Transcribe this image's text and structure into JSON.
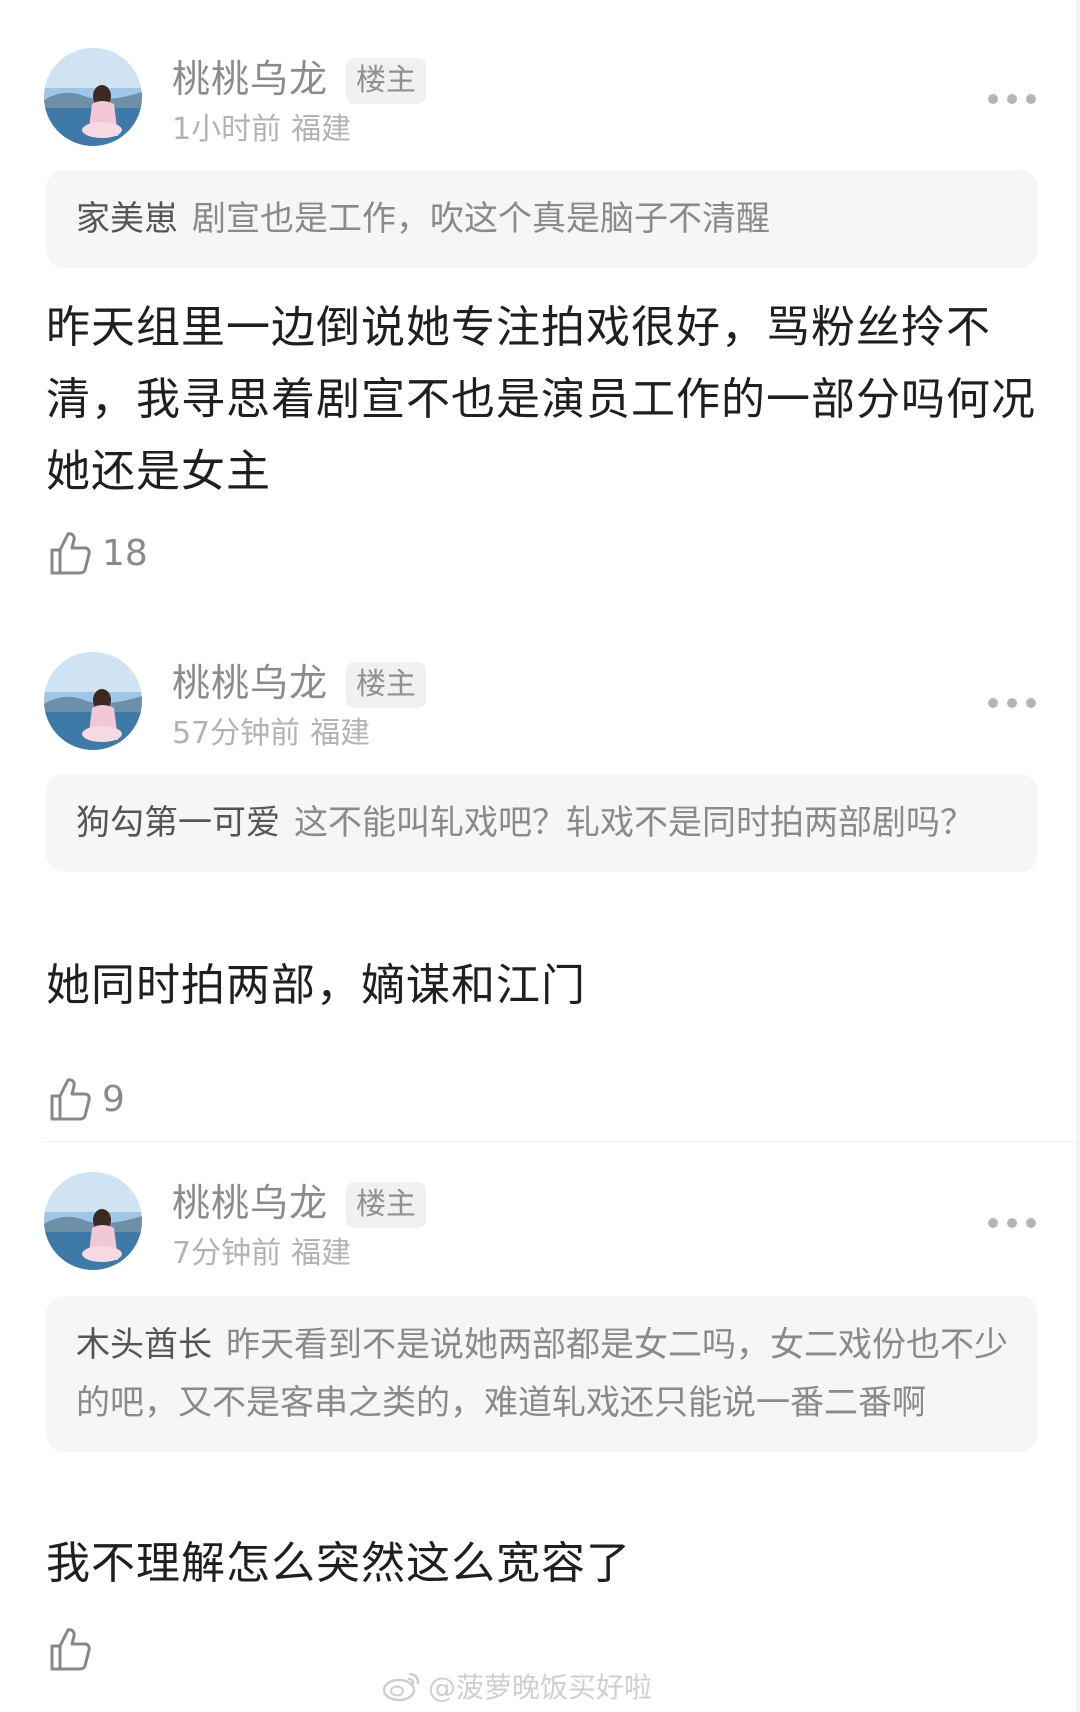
{
  "comments": [
    {
      "username": "桃桃乌龙",
      "badge": "楼主",
      "time": "1小时前",
      "location": "福建",
      "quote_name": "家美崽",
      "quote_text": "剧宣也是工作，吹这个真是脑子不清醒",
      "text": "昨天组里一边倒说她专注拍戏很好，骂粉丝拎不清，我寻思着剧宣不也是演员工作的一部分吗何况她还是女主",
      "likes": "18"
    },
    {
      "username": "桃桃乌龙",
      "badge": "楼主",
      "time": "57分钟前",
      "location": "福建",
      "quote_name": "狗勾第一可爱",
      "quote_text": "这不能叫轧戏吧？轧戏不是同时拍两部剧吗？",
      "text": "她同时拍两部，嫡谋和江门",
      "likes": "9"
    },
    {
      "username": "桃桃乌龙",
      "badge": "楼主",
      "time": "7分钟前",
      "location": "福建",
      "quote_name": "木头酋长",
      "quote_text": "昨天看到不是说她两部都是女二吗，女二戏份也不少的吧，又不是客串之类的，难道轧戏还只能说一番二番啊",
      "text": "我不理解怎么突然这么宽容了",
      "likes": ""
    }
  ],
  "watermark": "@菠萝晚饭买好啦",
  "icons": {
    "avatar": "avatar-photo",
    "more": "more-dots-icon",
    "like": "thumbs-up-icon",
    "watermark": "weibo-logo-icon"
  }
}
